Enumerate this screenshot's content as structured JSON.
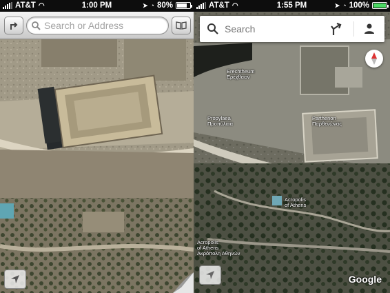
{
  "left_phone": {
    "status": {
      "carrier": "AT&T",
      "time": "1:00 PM",
      "battery_percent": "80%",
      "battery_level": 0.8
    },
    "toolbar": {
      "search_placeholder": "Search or Address"
    }
  },
  "right_phone": {
    "status": {
      "carrier": "AT&T",
      "time": "1:55 PM",
      "battery_percent": "100%",
      "battery_level": 1.0
    },
    "search": {
      "placeholder": "Search"
    },
    "map_labels": {
      "erechtheum_en": "Erechtheum",
      "erechtheum_gr": "Ερέχθειον",
      "propylaea_en": "Propylaea",
      "propylaea_gr": "Προπύλαια",
      "parthenon_en": "Parthenon",
      "parthenon_gr": "Παρθενώνας",
      "acropolis_en": "Acropolis",
      "acropolis_gr": "of Athens",
      "acropolis_bottom_1": "Acropolis",
      "acropolis_bottom_2": "of Athens",
      "acropolis_bottom_3": "Ακρόπολη Αθηνών"
    },
    "attribution": "Google"
  },
  "colors": {
    "accent_green": "#4cd964"
  }
}
